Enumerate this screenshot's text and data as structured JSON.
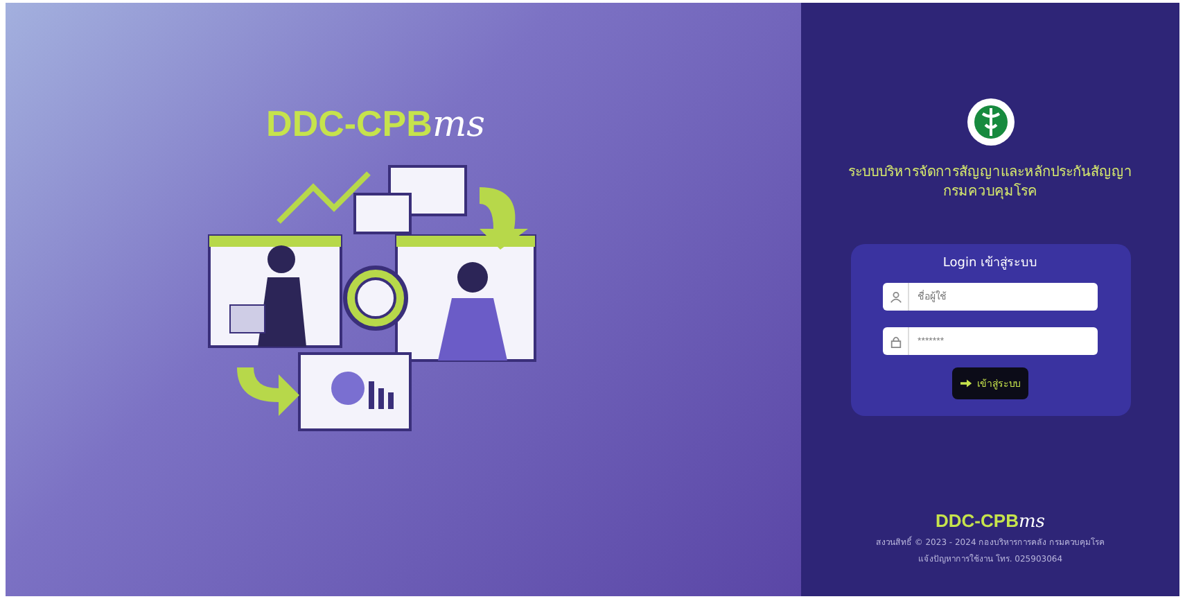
{
  "brand": {
    "name": "DDC-CPB",
    "suffix": "ms"
  },
  "header": {
    "title": "ระบบบริหารจัดการสัญญาและหลักประกันสัญญา",
    "subtitle": "กรมควบคุมโรค"
  },
  "login": {
    "title": "Login เข้าสู่ระบบ",
    "fields": [
      {
        "kind": "user",
        "placeholder": "ชื่อผู้ใช้"
      },
      {
        "kind": "password",
        "placeholder": "*******"
      }
    ],
    "button": "เข้าสู่ระบบ"
  },
  "footer": {
    "brand": {
      "name": "DDC-CPB",
      "suffix": "ms"
    },
    "copyright": "สงวนสิทธิ์ © 2023 - 2024 กองบริหารการคลัง กรมควบคุมโรค",
    "contact": "แจ้งปัญหาการใช้งาน โทร. 025903064"
  }
}
